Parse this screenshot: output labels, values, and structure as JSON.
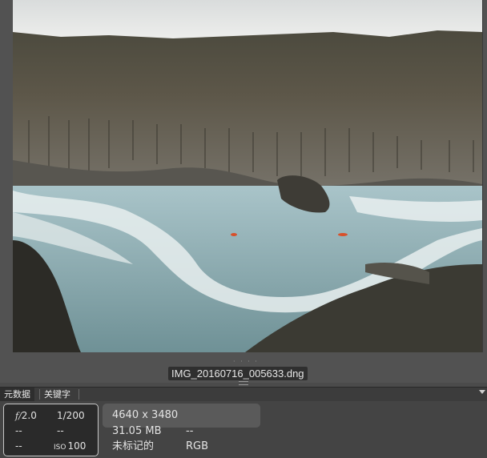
{
  "preview": {
    "filename": "IMG_20160716_005633.dng",
    "handle": "· · · ·"
  },
  "tabs": [
    {
      "label": "元数据",
      "active": true
    },
    {
      "label": "关键字",
      "active": false
    }
  ],
  "camera": {
    "aperture_prefix": "f/",
    "aperture": "2.0",
    "shutter": "1/200",
    "row2_left": "--",
    "row2_right": "--",
    "row3_left": "--",
    "iso_label": "ISO",
    "iso": "100"
  },
  "file_info": {
    "dimensions": "4640 x 3480",
    "size": "31.05 MB",
    "size_extra": "--",
    "rating": "未标记的",
    "color_mode": "RGB"
  },
  "colors": {
    "panel_bg": "#444444",
    "tab_active": "#2e2e2e",
    "camera_border": "#c8c8c8"
  }
}
